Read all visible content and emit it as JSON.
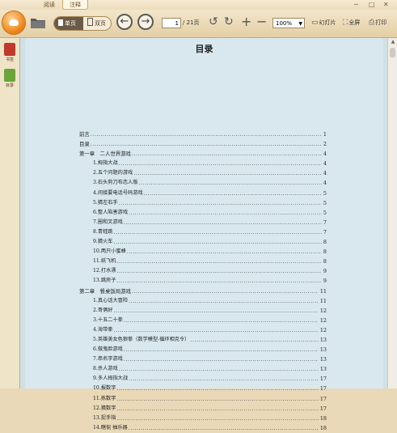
{
  "app": {
    "tabs": [
      {
        "label": "阅读"
      },
      {
        "label": "注释"
      }
    ],
    "window_controls": [
      "─",
      "□",
      "✕"
    ]
  },
  "toolbar": {
    "view_single": "单页",
    "view_double": "双页",
    "current_page": "1",
    "total_pages": "/ 21页",
    "zoom": "100%",
    "slideshow": "幻灯片",
    "fullscreen": "全屏",
    "print": "打印"
  },
  "sidebar": {
    "items": [
      {
        "label": "书签",
        "color": "#c0392b"
      },
      {
        "label": "目录",
        "color": "#6aa43a"
      }
    ]
  },
  "document": {
    "title": "目录",
    "toc": [
      {
        "text": "前言",
        "page": "1",
        "level": 0
      },
      {
        "text": "目录",
        "page": "2",
        "level": 0
      },
      {
        "text": "第一章　二人世界游戏",
        "page": "4",
        "level": 0
      },
      {
        "text": "1.拇指大战",
        "page": "4",
        "level": 1
      },
      {
        "text": "2.五个问题的游戏",
        "page": "4",
        "level": 1
      },
      {
        "text": "3.石头剪刀布恋人版",
        "page": "4",
        "level": 1
      },
      {
        "text": "4.间接要电话号码游戏",
        "page": "5",
        "level": 1
      },
      {
        "text": "5.猜左右手",
        "page": "5",
        "level": 1
      },
      {
        "text": "6.整人陷害游戏",
        "page": "5",
        "level": 1
      },
      {
        "text": "7.圈和叉游戏",
        "page": "7",
        "level": 1
      },
      {
        "text": "8.青蛙跳",
        "page": "7",
        "level": 1
      },
      {
        "text": "9.猜火车",
        "page": "8",
        "level": 1
      },
      {
        "text": "10.两只小蜜蜂",
        "page": "8",
        "level": 1
      },
      {
        "text": "11.纸飞机",
        "page": "8",
        "level": 1
      },
      {
        "text": "12.打水漂",
        "page": "9",
        "level": 1
      },
      {
        "text": "13.跳房子",
        "page": "9",
        "level": 1
      },
      {
        "text": "第二章　餐桌饭局游戏",
        "page": "11",
        "level": 0
      },
      {
        "text": "1.真心话大冒险",
        "page": "11",
        "level": 1
      },
      {
        "text": "2.哥俩好",
        "page": "12",
        "level": 1
      },
      {
        "text": "3.十五二十拳",
        "page": "12",
        "level": 1
      },
      {
        "text": "4.海带拳",
        "page": "12",
        "level": 1
      },
      {
        "text": "5.英雄美女色狼拳（数学模型-循环相克令）",
        "page": "13",
        "level": 1
      },
      {
        "text": "6.做鬼脸游戏",
        "page": "13",
        "level": 1
      },
      {
        "text": "7.串名字游戏",
        "page": "13",
        "level": 1
      },
      {
        "text": "8.杀人游戏",
        "page": "13",
        "level": 1
      },
      {
        "text": "9.多人拇指大战",
        "page": "17",
        "level": 1
      },
      {
        "text": "10.报数字",
        "page": "17",
        "level": 1
      },
      {
        "text": "11.拣数字",
        "page": "17",
        "level": 1
      },
      {
        "text": "12.猜数字",
        "page": "17",
        "level": 1
      },
      {
        "text": "13.捉手指",
        "page": "18",
        "level": 1
      },
      {
        "text": "14.瞎侃 抽乐器",
        "page": "18",
        "level": 1
      }
    ]
  },
  "colors": {
    "accent_orange": "#f28a1e",
    "page_bg": "#d8e8ee",
    "frame_bg": "#e9d9b8"
  }
}
